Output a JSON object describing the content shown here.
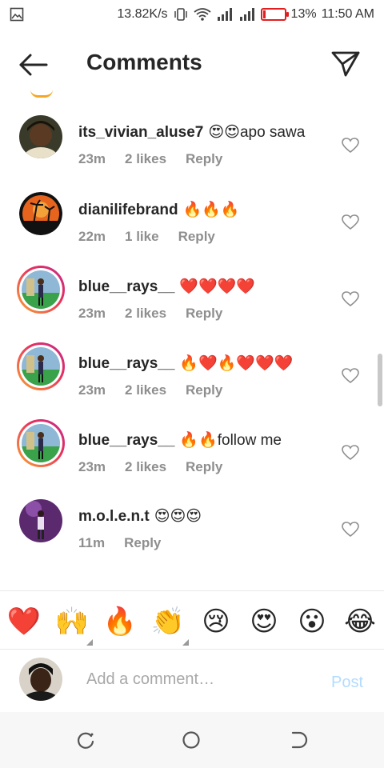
{
  "status_bar": {
    "network_speed": "13.82K/s",
    "battery_percent": "13%",
    "battery_level": 0.13,
    "time": "11:50 AM"
  },
  "header": {
    "title": "Comments"
  },
  "comments": [
    {
      "username": "its_vivian_aluse7",
      "text": "😍😍apo sawa",
      "time": "23m",
      "likes": "2 likes",
      "reply": "Reply"
    },
    {
      "username": "dianilifebrand",
      "text": "🔥🔥🔥",
      "time": "22m",
      "likes": "1 like",
      "reply": "Reply"
    },
    {
      "username": "blue__rays__",
      "text": "❤️❤️❤️❤️",
      "time": "23m",
      "likes": "2 likes",
      "reply": "Reply"
    },
    {
      "username": "blue__rays__",
      "text": "🔥❤️🔥❤️❤️❤️",
      "time": "23m",
      "likes": "2 likes",
      "reply": "Reply"
    },
    {
      "username": "blue__rays__",
      "text": "🔥🔥follow me",
      "time": "23m",
      "likes": "2 likes",
      "reply": "Reply"
    },
    {
      "username": "m.o.l.e.n.t",
      "text": "😍😍😍",
      "time": "11m",
      "likes": "",
      "reply": "Reply"
    }
  ],
  "emoji_bar": [
    "❤️",
    "🙌",
    "🔥",
    "👏",
    "😢",
    "😍",
    "😮",
    "😂"
  ],
  "composer": {
    "placeholder": "Add a comment…",
    "post_label": "Post"
  },
  "colors": {
    "text": "#262626",
    "meta": "#8e8e8e",
    "post_disabled": "#b3dbff",
    "story_ring": "#e8305c"
  }
}
